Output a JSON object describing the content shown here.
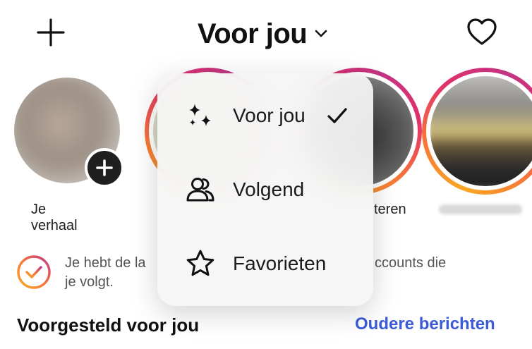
{
  "header": {
    "title": "Voor jou",
    "icons": {
      "left": "plus-icon",
      "title_caret": "chevron-down-icon",
      "right": "heart-icon"
    }
  },
  "stories": {
    "items": [
      {
        "label": "Je verhaal",
        "badge_icon": "plus-circle-icon"
      },
      {
        "label": ""
      },
      {
        "label": ""
      },
      {
        "label": "teren"
      },
      {
        "label": ""
      }
    ]
  },
  "notice": {
    "line1_left": "Je hebt de la",
    "line1_right": "ccounts die",
    "line2": "je volgt.",
    "icon": "check-circle-icon"
  },
  "suggested": {
    "title": "Voorgesteld voor jou",
    "older_link": "Oudere berichten"
  },
  "feed_menu": {
    "items": [
      {
        "label": "Voor jou",
        "icon": "sparkles-icon",
        "selected": true
      },
      {
        "label": "Volgend",
        "icon": "people-icon",
        "selected": false
      },
      {
        "label": "Favorieten",
        "icon": "star-icon",
        "selected": false
      }
    ],
    "selected_icon": "checkmark-icon"
  },
  "colors": {
    "story_ring": [
      "#f9a825",
      "#f77737",
      "#e1306c",
      "#c13584"
    ],
    "link": "#3c5bd6",
    "text": "#111111"
  }
}
